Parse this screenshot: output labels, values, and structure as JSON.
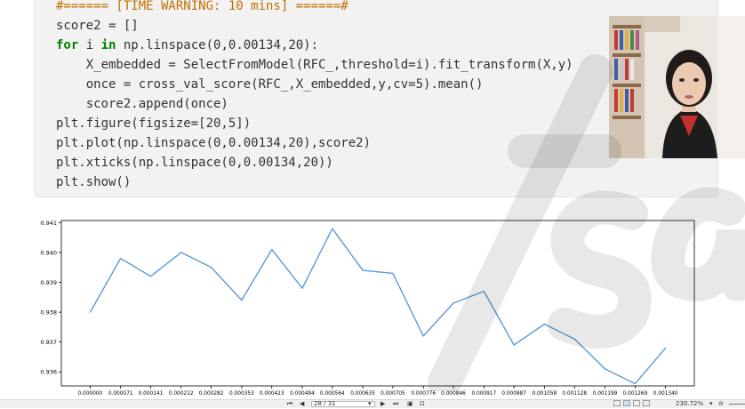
{
  "code": {
    "lines": [
      {
        "kind": "comment",
        "text": "#====== [TIME WARNING: 10 mins] ======#"
      },
      {
        "kind": "code",
        "text": "score2 = []"
      },
      {
        "kind": "for",
        "kw": "for",
        "kw2": "in",
        "pre": "i ",
        "post": " np.linspace(0,0.00134,20):"
      },
      {
        "kind": "code",
        "text": "    X_embedded = SelectFromModel(RFC_,threshold=i).fit_transform(X,y)"
      },
      {
        "kind": "code",
        "text": "    once = cross_val_score(RFC_,X_embedded,y,cv=5).mean()"
      },
      {
        "kind": "code",
        "text": "    score2.append(once)"
      },
      {
        "kind": "code",
        "text": "plt.figure(figsize=[20,5])"
      },
      {
        "kind": "code",
        "text": "plt.plot(np.linspace(0,0.00134,20),score2)"
      },
      {
        "kind": "code",
        "text": "plt.xticks(np.linspace(0,0.00134,20))"
      },
      {
        "kind": "code",
        "text": "plt.show()"
      }
    ]
  },
  "chart_data": {
    "type": "line",
    "x": [
      0.0,
      7.1e-05,
      0.000141,
      0.000212,
      0.000282,
      0.000353,
      0.000423,
      0.000494,
      0.000564,
      0.000635,
      0.000705,
      0.000776,
      0.000846,
      0.000917,
      0.000987,
      0.001058,
      0.001128,
      0.001199,
      0.001269,
      0.00134
    ],
    "x_tick_labels": [
      "0.000000",
      "0.000071",
      "0.000141",
      "0.000212",
      "0.000282",
      "0.000353",
      "0.000423",
      "0.000494",
      "0.000564",
      "0.000635",
      "0.000705",
      "0.000776",
      "0.000846",
      "0.000917",
      "0.000987",
      "0.001058",
      "0.001128",
      "0.001199",
      "0.001269",
      "0.001340"
    ],
    "series": [
      {
        "values": [
          0.938,
          0.9398,
          0.9392,
          0.94,
          0.9395,
          0.9384,
          0.9401,
          0.9388,
          0.9408,
          0.9394,
          0.9393,
          0.9372,
          0.9383,
          0.9387,
          0.9369,
          0.9376,
          0.9371,
          0.9361,
          0.9356,
          0.9368
        ],
        "color": "#5b9bd5"
      }
    ],
    "y_ticks": [
      "0.936",
      "0.937",
      "0.938",
      "0.939",
      "0.940",
      "0.941"
    ],
    "y_tick_values": [
      0.936,
      0.937,
      0.938,
      0.939,
      0.94,
      0.941
    ],
    "xlim": [
      -6.7e-05,
      0.001407
    ],
    "ylim": [
      0.93553,
      0.94107
    ],
    "title": "",
    "xlabel": "",
    "ylabel": "",
    "grid": false
  },
  "status_bar": {
    "page_indicator": "28 / 31",
    "zoom": "230.72%"
  },
  "colors": {
    "cell_bg": "#f2f2f2",
    "keyword": "#008000",
    "comment": "#c07000",
    "line": "#5b9bd5"
  }
}
